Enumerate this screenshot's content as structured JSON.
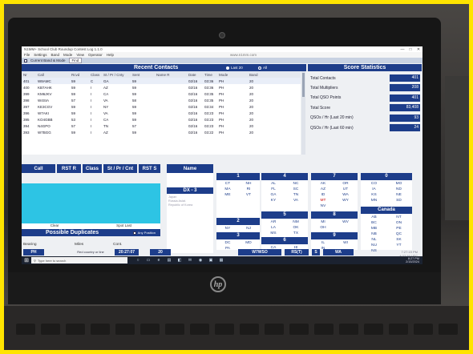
{
  "window": {
    "title": "N1MM+ School Club Roundup Contest Log 1.1.0",
    "minimize": "—",
    "maximize": "□",
    "close": "✕"
  },
  "menu": [
    "File",
    "Settings",
    "Band",
    "Mode",
    "View",
    "Operator",
    "Help"
  ],
  "url": "www.n1mm.com",
  "bandbar": {
    "checkbox_label": "Current Band & Mode",
    "button": "Find"
  },
  "recent_contacts": {
    "title": "Recent Contacts",
    "filter_last20": "Last 20",
    "filter_all": "All",
    "columns": [
      "Nr",
      "Call",
      "Rcvd",
      "Class",
      "St / Pr / Cnty",
      "Sent",
      "Name R",
      "Date",
      "Time",
      "Mode",
      "Band"
    ],
    "rows": [
      [
        "401",
        "W8AMC",
        "59",
        "C",
        "GA",
        "59",
        "",
        "02/16",
        "03:36",
        "PH",
        "20"
      ],
      [
        "400",
        "KB7AHK",
        "59",
        "I",
        "AZ",
        "59",
        "",
        "02/16",
        "03:36",
        "PH",
        "20"
      ],
      [
        "399",
        "KM6JKV",
        "59",
        "I",
        "CA",
        "59",
        "",
        "02/16",
        "03:35",
        "PH",
        "20"
      ],
      [
        "398",
        "W4SIA",
        "57",
        "I",
        "VA",
        "58",
        "",
        "02/16",
        "03:35",
        "PH",
        "20"
      ],
      [
        "397",
        "KE3CGV",
        "59",
        "I",
        "NY",
        "59",
        "",
        "02/16",
        "03:34",
        "PH",
        "20"
      ],
      [
        "396",
        "W7AKI",
        "59",
        "I",
        "VA",
        "59",
        "",
        "02/16",
        "03:23",
        "PH",
        "20"
      ],
      [
        "395",
        "KO4GBB",
        "53",
        "I",
        "CA",
        "59",
        "",
        "02/16",
        "03:23",
        "PH",
        "20"
      ],
      [
        "394",
        "N4GPO",
        "57",
        "I",
        "TN",
        "57",
        "",
        "02/16",
        "03:23",
        "PH",
        "20"
      ],
      [
        "393",
        "W7BGG",
        "59",
        "I",
        "AZ",
        "59",
        "",
        "02/16",
        "03:22",
        "PH",
        "20"
      ]
    ]
  },
  "score": {
    "title": "Score Statistics",
    "items": [
      {
        "label": "Total Contacts",
        "value": "401"
      },
      {
        "label": "Total Multipliers",
        "value": "208"
      },
      {
        "label": "Total QSO Points",
        "value": "401"
      },
      {
        "label": "Total Score",
        "value": "83,408"
      },
      {
        "label": "QSOs / Hr (Last 20 min)",
        "value": "93"
      },
      {
        "label": "QSOs / Hr (Last 60 min)",
        "value": "24"
      }
    ]
  },
  "entry": {
    "call": "Call",
    "rstr": "RST R",
    "class": "Class",
    "stprcnt": "St / Pr / Cnt",
    "rsts": "RST S",
    "name": "Name",
    "clear": "Clear",
    "spot_last": "Spot Last"
  },
  "duplicates": {
    "title": "Possible Duplicates",
    "any_position": "Any Position"
  },
  "dx": {
    "title": "DX - 3",
    "lines": [
      "Japan",
      "Russia Asiat.",
      "Republic of Korea"
    ]
  },
  "regions": {
    "r1": {
      "title": "1",
      "states": [
        "CT",
        "NH",
        "MA",
        "RI",
        "ME",
        "VT"
      ]
    },
    "r2": {
      "title": "2",
      "states": [
        "NY",
        "NJ"
      ]
    },
    "r3": {
      "title": "3",
      "states": [
        "DC",
        "MD",
        "PA",
        ""
      ]
    },
    "r4": {
      "title": "4",
      "states": [
        "AL",
        "NC",
        "FL",
        "SC",
        "GA",
        "TN",
        "KY",
        "VA"
      ]
    },
    "r5": {
      "title": "5",
      "states": [
        "AR",
        "NM",
        "LA",
        "OK",
        "MS",
        "TX"
      ]
    },
    "r6": {
      "title": "6",
      "states": [
        "CA",
        "HI"
      ]
    },
    "r7": {
      "title": "7",
      "states": [
        "AK",
        "OR",
        "AZ",
        "UT",
        "ID",
        "WA",
        "MT",
        "WY",
        "NV",
        ""
      ]
    },
    "r8": {
      "title": "8",
      "states": [
        "MI",
        "WV",
        "OH",
        ""
      ]
    },
    "r9": {
      "title": "9",
      "states": [
        "IL",
        "WI",
        "IN",
        ""
      ]
    },
    "r0": {
      "title": "0",
      "states": [
        "CO",
        "MO",
        "IA",
        "ND",
        "KS",
        "NE",
        "MN",
        "SD"
      ]
    },
    "canada": {
      "title": "Canada",
      "states": [
        "AB",
        "NT",
        "BC",
        "ON",
        "MB",
        "PE",
        "NB",
        "QC",
        "NL",
        "SK",
        "NU",
        "YT",
        "NS",
        ""
      ]
    }
  },
  "bottom": {
    "bearing_label": "Bearing",
    "miles_label": "Miles",
    "cont_label": "Cont.",
    "mode": "PH",
    "miles_value": "Red country or line",
    "cont_value": "",
    "time1": "20:27:07",
    "band": "20",
    "operator": "W7WSO",
    "rs": "RS(T)",
    "s": "S",
    "state": "WA",
    "clock1": "7:27:19 PM",
    "clock2": "4:27:19 UTC"
  },
  "taskbar": {
    "search_placeholder": "Type here to search",
    "time": "8:27 PM",
    "date": "2/15/2024"
  },
  "device_logo": "hp"
}
